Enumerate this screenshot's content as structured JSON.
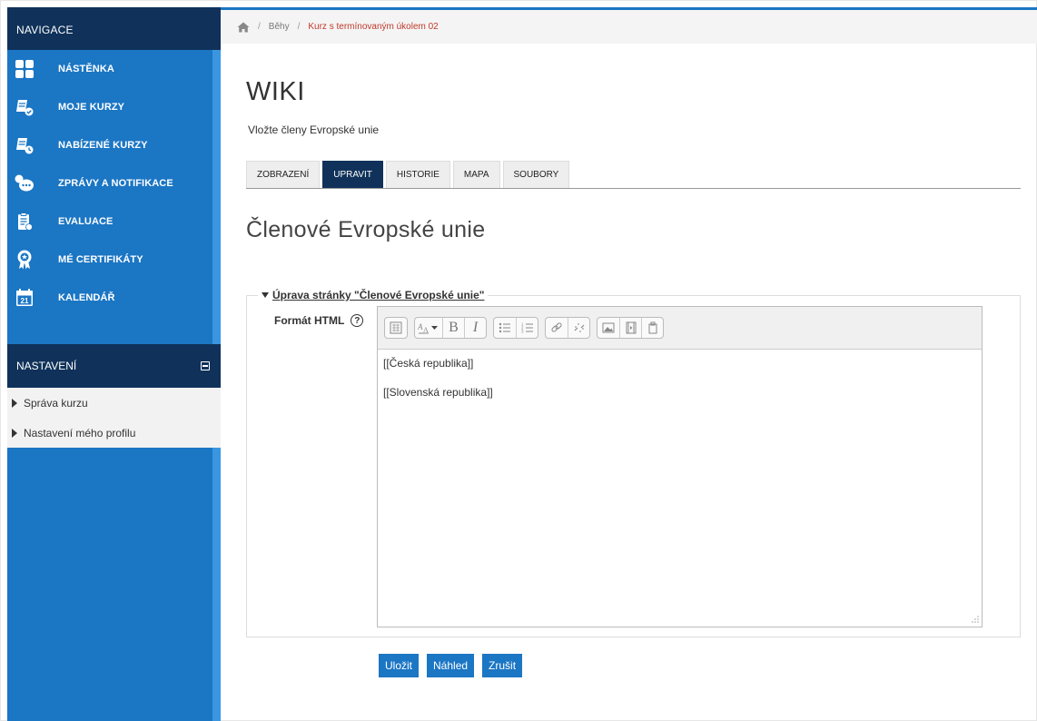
{
  "sidebar": {
    "nav_title": "NAVIGACE",
    "items": [
      {
        "label": "NÁSTĚNKA",
        "icon": "dashboard-icon"
      },
      {
        "label": "MOJE KURZY",
        "icon": "courses-icon"
      },
      {
        "label": "NABÍZENÉ KURZY",
        "icon": "offered-courses-icon"
      },
      {
        "label": "ZPRÁVY A NOTIFIKACE",
        "icon": "messages-icon"
      },
      {
        "label": "EVALUACE",
        "icon": "evaluation-icon"
      },
      {
        "label": "MÉ CERTIFIKÁTY",
        "icon": "certificate-icon"
      },
      {
        "label": "KALENDÁŘ",
        "icon": "calendar-icon"
      }
    ],
    "calendar_day": "21",
    "settings_title": "NASTAVENÍ",
    "settings_items": [
      {
        "label": "Správa kurzu"
      },
      {
        "label": "Nastavení mého profilu"
      }
    ]
  },
  "breadcrumb": {
    "items": [
      "Běhy",
      "Kurz s termínovaným úkolem 02"
    ]
  },
  "main": {
    "title": "WIKI",
    "subtitle": "Vložte členy Evropské unie",
    "tabs": [
      {
        "label": "ZOBRAZENÍ",
        "active": false
      },
      {
        "label": "UPRAVIT",
        "active": true
      },
      {
        "label": "HISTORIE",
        "active": false
      },
      {
        "label": "MAPA",
        "active": false
      },
      {
        "label": "SOUBORY",
        "active": false
      }
    ],
    "page_heading": "Členové Evropské unie"
  },
  "form": {
    "legend": "Úprava stránky \"Členové Evropské unie\"",
    "field_label": "Formát HTML",
    "editor_lines": [
      "[[Česká republika]]",
      "[[Slovenská republika]]"
    ],
    "toolbar": {
      "bold": "B",
      "italic": "I"
    },
    "buttons": {
      "save": "Uložit",
      "preview": "Náhled",
      "cancel": "Zrušit"
    }
  },
  "colors": {
    "sidebar_blue": "#1b76c4",
    "sidebar_dark": "#10325a",
    "accent_red": "#c0392b"
  }
}
